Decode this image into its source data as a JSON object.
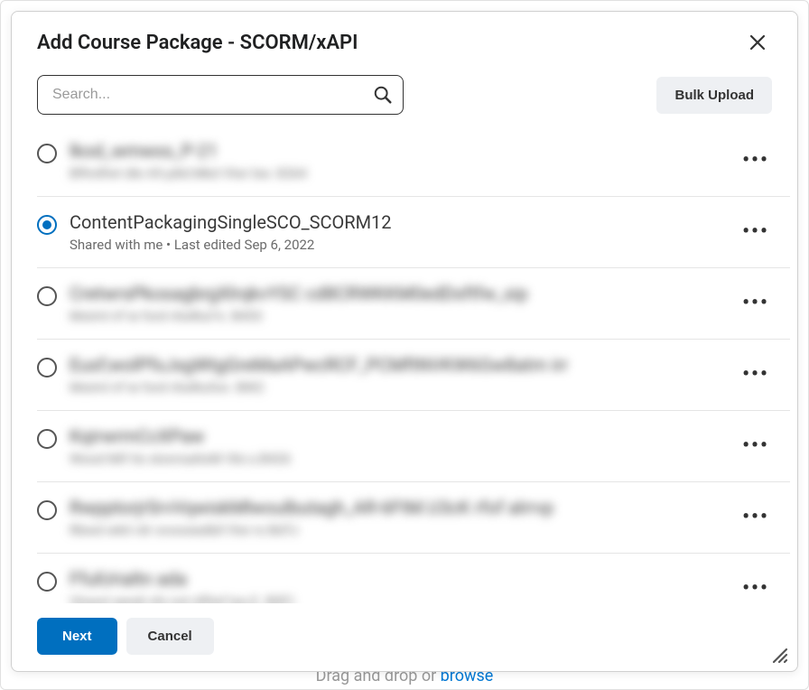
{
  "modal": {
    "title": "Add Course Package - SCORM/xAPI"
  },
  "search": {
    "placeholder": "Search..."
  },
  "bulk_upload_label": "Bulk Upload",
  "items": [
    {
      "title": "lkod_wmwxs_P-21",
      "meta": "Bfhrdfwt dle A9.p8d.Mkd Vlwr bw. 8264",
      "selected": false,
      "blurred": true
    },
    {
      "title": "ContentPackagingSingleSCO_SCORM12",
      "meta": "Shared with me  •  Last edited Sep 6, 2022",
      "selected": true,
      "blurred": false
    },
    {
      "title": "CretwrsPkosagbrgXlrqkvYSC cd8CRWKKM0edDsftfw_sip",
      "meta": "Moimt irf ie  ford rito8tuf k. B453",
      "selected": false,
      "blurred": true
    },
    {
      "title": "Eusf;wolPfsJsgWtgGreMaAPwcRCF_PCMftNVKW6Gw8atm irr",
      "meta": "Moimt irf ie  ford rito8tufon. BW2",
      "selected": false,
      "blurred": true
    },
    {
      "title": "KqirwrmCcXPaw",
      "meta": "Wood Mif its  stonrsaItoM Vbr.s.B426",
      "selected": false,
      "blurred": true
    },
    {
      "title": "RwpptorjrSrvVqwiskMlwoulbutagh_AR-6FtM.U3cK rfof alrrvp",
      "meta": "Rbwd wkit rdr  ovoosiedbif ifwi rs BdTJ",
      "selected": false,
      "blurred": true
    },
    {
      "title": "FfulUrialtn ada",
      "meta": "Vlxwol sendi xfs  ivd cRfwf tys.E. BSF)",
      "selected": false,
      "blurred": true
    }
  ],
  "footer": {
    "next": "Next",
    "cancel": "Cancel"
  },
  "backdrop": {
    "text_prefix": "Drag and drop or ",
    "link": "browse"
  }
}
